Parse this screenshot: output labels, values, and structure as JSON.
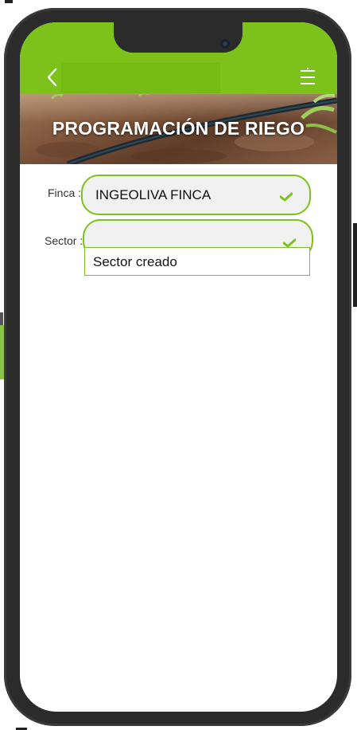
{
  "header": {
    "title": "PROGRAMACIÓN DE RIEGO",
    "back_icon": "chevron-left-icon",
    "menu_icon": "menu-icon",
    "accent_color": "#7cc21b"
  },
  "form": {
    "finca_label": "Finca :",
    "finca_value": "INGEOLIVA FINCA",
    "sector_label": "Sector :",
    "sector_value": "",
    "sector_options": [
      "Sector creado"
    ]
  }
}
